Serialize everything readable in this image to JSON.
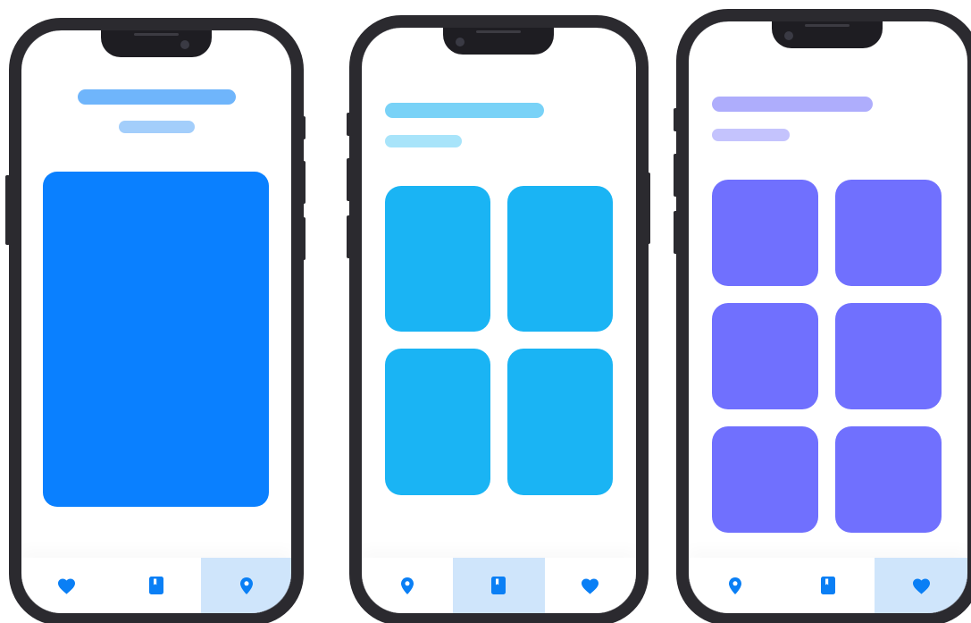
{
  "colors": {
    "frame": "#2b2a2f",
    "tab_icon": "#0a7ff5",
    "tab_active_bg": "#cfe5fb"
  },
  "screens": [
    {
      "title_color": "#6fb5fb",
      "subtitle_color": "#a3cefb",
      "card_color": "#0a80ff",
      "layout": "single-card",
      "card_count": 1,
      "tabs": [
        {
          "icon": "heart-icon",
          "active": false
        },
        {
          "icon": "book-icon",
          "active": false
        },
        {
          "icon": "location-pin-icon",
          "active": true
        }
      ]
    },
    {
      "title_color": "#79d2f7",
      "subtitle_color": "#a8e4fa",
      "card_color": "#1ab4f4",
      "layout": "grid-2x2",
      "card_count": 4,
      "tabs": [
        {
          "icon": "location-pin-icon",
          "active": false
        },
        {
          "icon": "book-icon",
          "active": true
        },
        {
          "icon": "heart-icon",
          "active": false
        }
      ]
    },
    {
      "title_color": "#aeadfc",
      "subtitle_color": "#c4c3fd",
      "card_color": "#7070fe",
      "layout": "grid-2x3",
      "card_count": 6,
      "tabs": [
        {
          "icon": "location-pin-icon",
          "active": false
        },
        {
          "icon": "book-icon",
          "active": false
        },
        {
          "icon": "heart-icon",
          "active": true
        }
      ]
    }
  ]
}
